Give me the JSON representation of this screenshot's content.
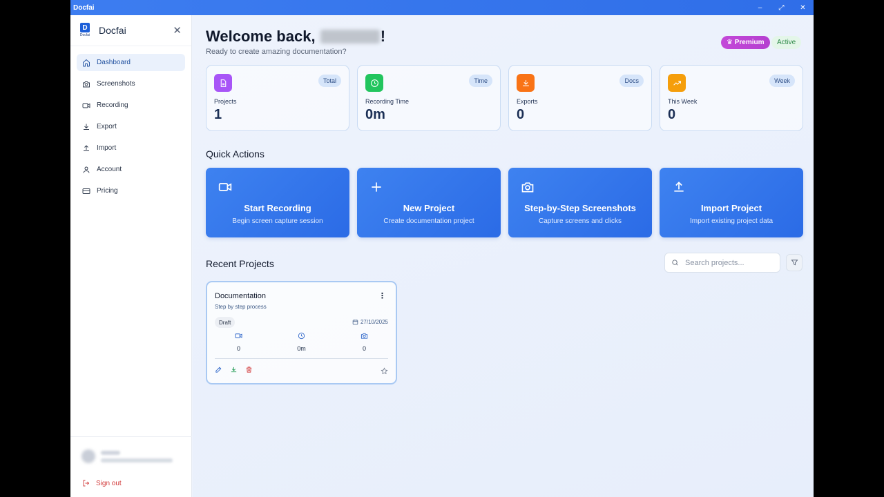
{
  "window": {
    "title": "Docfai",
    "controls": [
      "–",
      "⤢",
      "✕"
    ]
  },
  "sidebar": {
    "brand_name": "Docfai",
    "logo_letter": "D",
    "logo_text": "Docfai",
    "close": "✕",
    "items": [
      {
        "label": "Dashboard",
        "icon": "home-icon",
        "active": true
      },
      {
        "label": "Screenshots",
        "icon": "camera-icon"
      },
      {
        "label": "Recording",
        "icon": "video-icon"
      },
      {
        "label": "Export",
        "icon": "download-icon"
      },
      {
        "label": "Import",
        "icon": "upload-icon"
      },
      {
        "label": "Account",
        "icon": "user-icon"
      },
      {
        "label": "Pricing",
        "icon": "card-icon"
      }
    ],
    "sign_out": "Sign out"
  },
  "header": {
    "welcome_prefix": "Welcome back,",
    "welcome_suffix": "!",
    "subtitle": "Ready to create amazing documentation?",
    "premium_badge": "♛ Premium",
    "status_badge": "Active"
  },
  "stats": [
    {
      "label": "Projects",
      "value": "1",
      "tag": "Total",
      "icon": "file-icon",
      "color": "#a855f7"
    },
    {
      "label": "Recording Time",
      "value": "0m",
      "tag": "Time",
      "icon": "clock-icon",
      "color": "#22c55e"
    },
    {
      "label": "Exports",
      "value": "0",
      "tag": "Docs",
      "icon": "download-icon",
      "color": "#f97316"
    },
    {
      "label": "This Week",
      "value": "0",
      "tag": "Week",
      "icon": "trending-icon",
      "color": "#f59e0b"
    }
  ],
  "quick_actions": {
    "title": "Quick Actions",
    "items": [
      {
        "title": "Start Recording",
        "subtitle": "Begin screen capture session",
        "icon": "video-icon"
      },
      {
        "title": "New Project",
        "subtitle": "Create documentation project",
        "icon": "plus-icon"
      },
      {
        "title": "Step-by-Step Screenshots",
        "subtitle": "Capture screens and clicks",
        "icon": "camera-icon"
      },
      {
        "title": "Import Project",
        "subtitle": "Import existing project data",
        "icon": "upload-icon"
      }
    ]
  },
  "recent": {
    "title": "Recent Projects",
    "search_placeholder": "Search projects...",
    "project": {
      "title": "Documentation",
      "description": "Step by step process",
      "status": "Draft",
      "date": "27/10/2025",
      "recordings": "0",
      "time": "0m",
      "screenshots": "0",
      "menu": "⋮"
    }
  },
  "colors": {
    "accent": "#2f6ee8",
    "premium": "#c348d8",
    "danger": "#d23b3b",
    "success": "#2e8a48"
  }
}
